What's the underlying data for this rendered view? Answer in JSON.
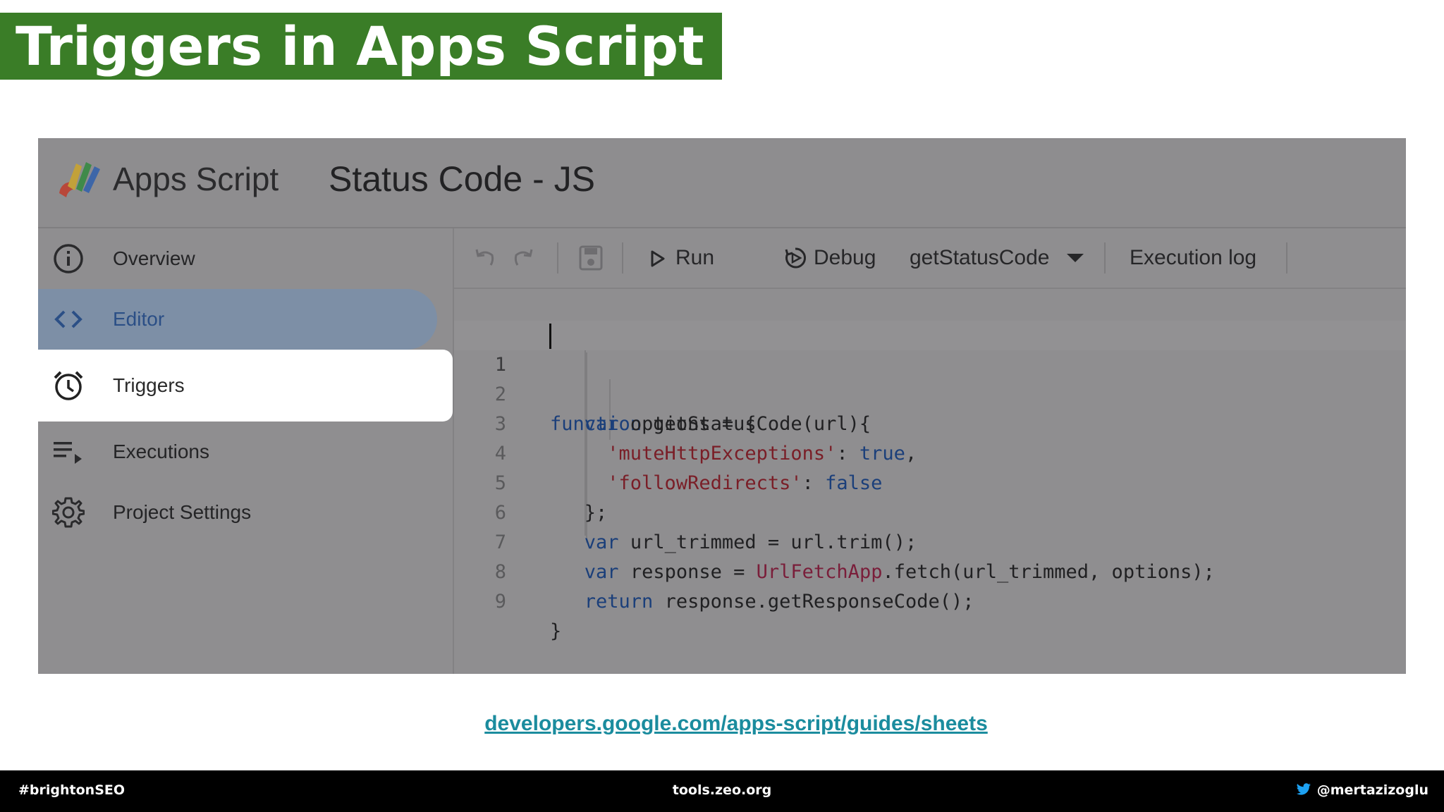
{
  "slide": {
    "title": "Triggers in Apps Script",
    "link": "developers.google.com/apps-script/guides/sheets",
    "colors": {
      "title_bg": "#3a7d27",
      "link": "#1b8c9e",
      "footer_bg": "#000000"
    }
  },
  "app": {
    "name": "Apps Script",
    "project": "Status Code - JS",
    "logo_icon": "apps-script-logo"
  },
  "sidebar": {
    "items": [
      {
        "label": "Overview",
        "icon": "info-icon"
      },
      {
        "label": "Editor",
        "icon": "code-icon"
      },
      {
        "label": "Triggers",
        "icon": "alarm-clock-icon"
      },
      {
        "label": "Executions",
        "icon": "executions-list-icon"
      },
      {
        "label": "Project Settings",
        "icon": "gear-icon"
      }
    ],
    "selected": "Triggers"
  },
  "toolbar": {
    "run_label": "Run",
    "debug_label": "Debug",
    "function_select": "getStatusCode",
    "execution_log_label": "Execution log"
  },
  "code": {
    "line_numbers": [
      "1",
      "2",
      "3",
      "4",
      "5",
      "6",
      "7",
      "8",
      "9"
    ]
  },
  "footer": {
    "left": "#brightonSEO",
    "center": "tools.zeo.org",
    "right": "@mertazizoglu"
  }
}
